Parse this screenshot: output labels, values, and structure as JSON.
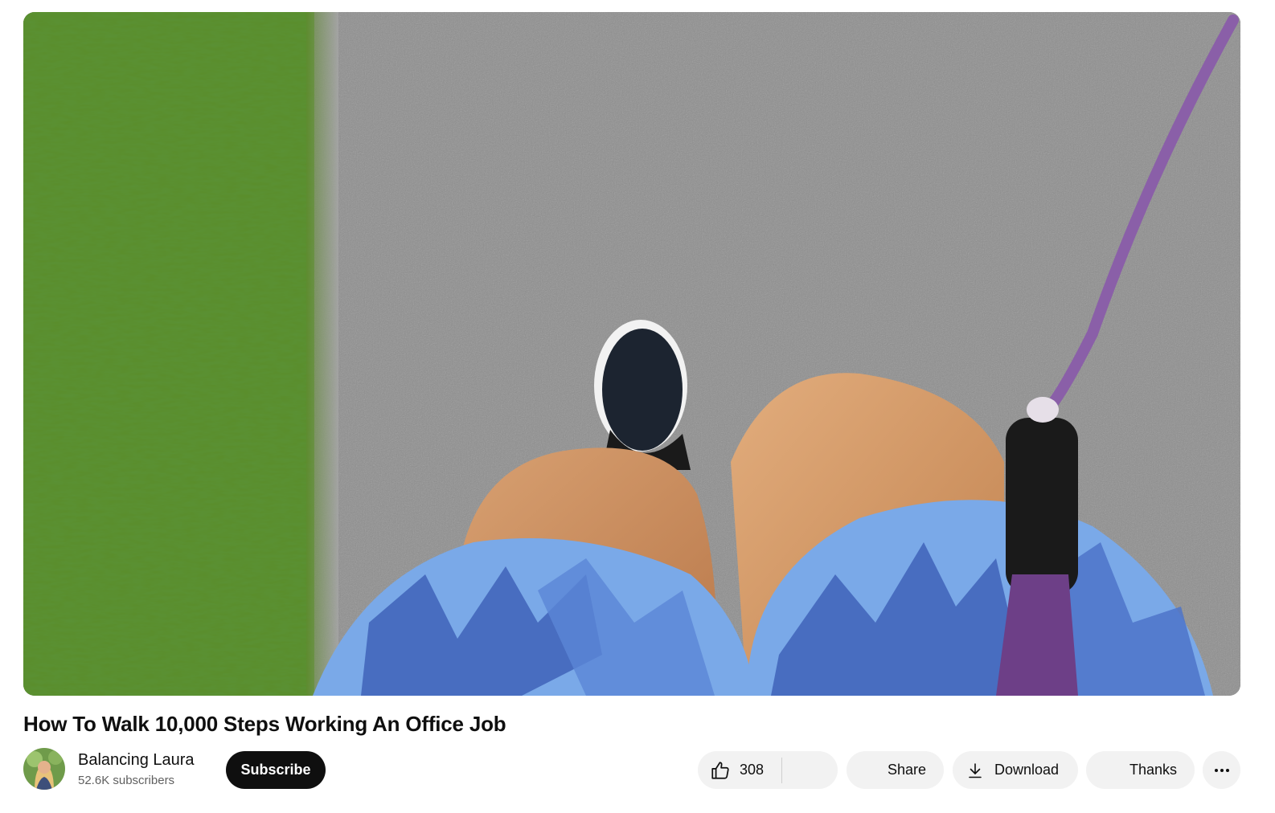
{
  "video": {
    "title": "How To Walk 10,000 Steps Working An Office Job"
  },
  "channel": {
    "name": "Balancing Laura",
    "subscribers": "52.6K subscribers",
    "subscribe_label": "Subscribe"
  },
  "actions": {
    "like_count": "308",
    "share_label": "Share",
    "download_label": "Download",
    "thanks_label": "Thanks"
  },
  "icons": {
    "like": "thumbs-up-icon",
    "download": "download-icon",
    "more": "more-horizontal-icon"
  },
  "colors": {
    "subscribe_bg": "#0f0f0f",
    "pill_bg": "#f2f2f2",
    "secondary_text": "#606060"
  }
}
